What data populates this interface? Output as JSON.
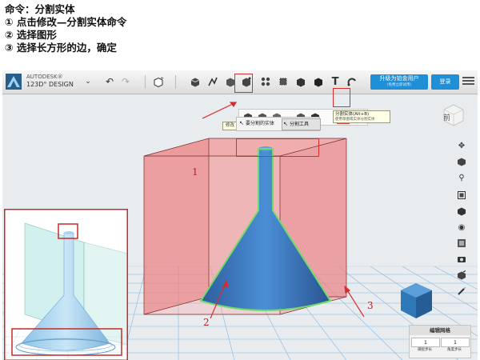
{
  "instructions": {
    "title": "命令：分割实体",
    "steps": [
      "① 点击修改—分割实体命令",
      "② 选择图形",
      "③ 选择长方形的边，确定"
    ]
  },
  "app": {
    "brand_top": "AUTODESK®",
    "brand_name": "123D° DESIGN",
    "upgrade_label": "升级为铂金用户",
    "upgrade_sub": "(免费立即试用)",
    "login_label": "登录"
  },
  "modify_tooltip": "修改",
  "split_tooltip": {
    "title": "分割实体(Alt+B)",
    "desc": "使用草图或实体分割实体"
  },
  "mode_bar": {
    "item1": "要分割的实体",
    "item2": "分割工具"
  },
  "viewcube_label": "前",
  "grid_panel": {
    "title": "编辑网格",
    "value_left": "1",
    "value_right": "1",
    "label_left": "捕捉步长",
    "label_right": "角度步长"
  },
  "annotations": [
    "1",
    "2",
    "3"
  ],
  "colors": {
    "accent": "#1f8fd8",
    "highlight": "#d62e2e",
    "box_fill": "#f07a7a",
    "funnel": "#3d7fc6",
    "outline": "#6fdc6a"
  }
}
